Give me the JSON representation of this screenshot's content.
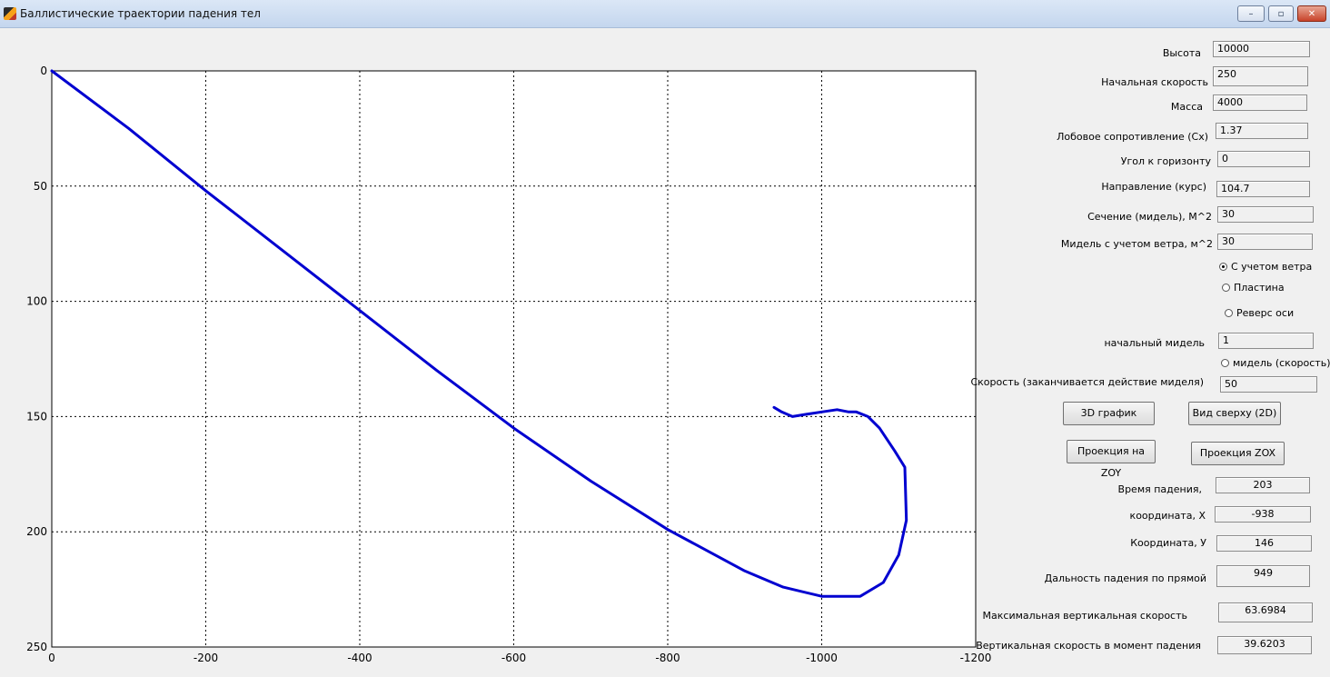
{
  "window": {
    "title": "Баллистические траектории падения тел",
    "minimize_label": "–",
    "restore_label": "▫",
    "close_label": "✕"
  },
  "chart_data": {
    "type": "line",
    "title": "",
    "xlabel": "",
    "ylabel": "",
    "xlim": [
      0,
      -1200
    ],
    "ylim": [
      0,
      250
    ],
    "x_reversed": true,
    "y_reversed": true,
    "grid": true,
    "x_ticks": [
      "0",
      "-200",
      "-400",
      "-600",
      "-800",
      "-1000",
      "-1200"
    ],
    "y_ticks": [
      "0",
      "50",
      "100",
      "150",
      "200",
      "250"
    ],
    "line_color": "#0000d0",
    "series": [
      {
        "x": [
          0,
          -100,
          -200,
          -300,
          -400,
          -500,
          -600,
          -700,
          -800,
          -900,
          -950,
          -1000,
          -1050,
          -1080,
          -1100,
          -1110,
          -1108,
          -1095,
          -1075,
          -1060,
          -1045,
          -1035,
          -1020,
          -1000,
          -980,
          -962,
          -948,
          -938
        ],
        "y": [
          0,
          25,
          52,
          78,
          104,
          130,
          155,
          178,
          199,
          217,
          224,
          228,
          228,
          222,
          210,
          195,
          172,
          165,
          155,
          150,
          148,
          148,
          147,
          148,
          149,
          150,
          148,
          146
        ]
      }
    ]
  },
  "params": {
    "height_label": "Высота",
    "height": "10000",
    "speed_label": "Начальная скорость",
    "speed": "250",
    "mass_label": "Масса",
    "mass": "4000",
    "drag_label": "Лобовое сопротивление (Cx)",
    "drag": "1.37",
    "angle_label": "Угол к горизонту",
    "angle": "0",
    "course_label": "Направление  (курс)",
    "course": "104.7",
    "section_label": "Сечение (мидель), M^2",
    "section": "30",
    "wind_midel_label": "Мидель с учетом ветра, м^2",
    "wind_midel": "30",
    "initial_midel_label": "начальный мидель",
    "initial_midel": "1",
    "end_speed_label": "Скорость (заканчивается действие миделя)",
    "end_speed": "50"
  },
  "options": {
    "with_wind": "С учетом ветра",
    "plate": "Пластина",
    "reverse_axis": "Реверс оси",
    "midel_speed": "мидель (скорость)"
  },
  "buttons": {
    "graph3d": "3D график",
    "top_view": "Вид сверху (2D)",
    "proj_zoy": "Проекция на ZOY",
    "proj_zox": "Проекция ZOX"
  },
  "results": {
    "time_label": "Время падения,",
    "time": "203",
    "coord_x_label": "координата, X",
    "coord_x": "-938",
    "coord_y_label": "Координата, У",
    "coord_y": "146",
    "distance_label": "Дальность падения по прямой",
    "distance": "949",
    "max_vspeed_label": "Максимальная вертикальная скорость",
    "max_vspeed": "63.6984",
    "impact_vspeed_label": "Вертикальная  скорость в момент падения",
    "impact_vspeed": "39.6203"
  }
}
